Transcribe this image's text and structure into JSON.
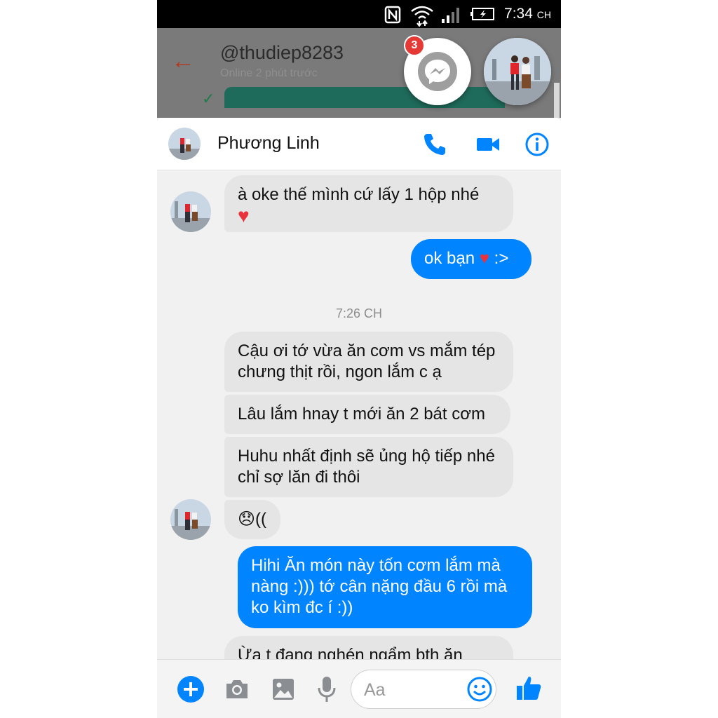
{
  "status_bar": {
    "time": "7:34",
    "time_suffix": "CH"
  },
  "background_app": {
    "username": "@thudiep8283",
    "online_status": "Online 2 phút trước"
  },
  "chat_heads": {
    "unread_badge": "3"
  },
  "header": {
    "contact_name": "Phương Linh"
  },
  "messages": [
    {
      "from": "them",
      "text": "à oke thế mình cứ lấy 1 hộp nhé",
      "emoji": "♥"
    },
    {
      "from": "me",
      "text": "ok bạn",
      "emoji": "♥",
      "suffix": ":>"
    },
    {
      "from": "them",
      "text": "Cậu ơi tớ vừa ăn cơm vs mắm tép chưng thịt rồi, ngon lắm c ạ"
    },
    {
      "from": "them",
      "text": "Lâu lắm hnay t mới ăn 2 bát cơm"
    },
    {
      "from": "them",
      "text": "Huhu nhất định sẽ ủng hộ tiếp nhé chỉ sợ lăn đi thôi"
    },
    {
      "from": "them",
      "text": "((",
      "emoji": "😞"
    },
    {
      "from": "me",
      "text": "Hihi Ăn món này tốn cơm lắm mà nàng :))) tớ cân nặng đầu 6 rồi mà ko kìm đc í :))"
    },
    {
      "from": "them",
      "text": "Ừa t đang nghén ngẩm bth ăn"
    }
  ],
  "timestamp": "7:26 CH",
  "composer": {
    "placeholder": "Aa"
  },
  "colors": {
    "accent": "#0084ff",
    "incoming_bubble": "#e5e5e5",
    "heart": "#e8333c"
  }
}
